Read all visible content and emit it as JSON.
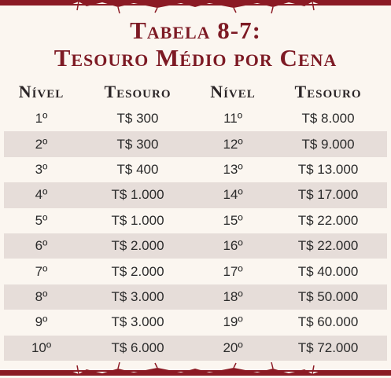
{
  "title": {
    "line1": "Tabela 8-7:",
    "line2": "Tesouro Médio por Cena"
  },
  "header": {
    "level_left": "Nível",
    "treasure_left": "Tesouro",
    "level_right": "Nível",
    "treasure_right": "Tesouro"
  },
  "rows": [
    {
      "level_a": "1º",
      "treasure_a": "T$ 300",
      "level_b": "11º",
      "treasure_b": "T$ 8.000"
    },
    {
      "level_a": "2º",
      "treasure_a": "T$ 300",
      "level_b": "12º",
      "treasure_b": "T$ 9.000"
    },
    {
      "level_a": "3º",
      "treasure_a": "T$ 400",
      "level_b": "13º",
      "treasure_b": "T$ 13.000"
    },
    {
      "level_a": "4º",
      "treasure_a": "T$ 1.000",
      "level_b": "14º",
      "treasure_b": "T$ 17.000"
    },
    {
      "level_a": "5º",
      "treasure_a": "T$ 1.000",
      "level_b": "15º",
      "treasure_b": "T$ 22.000"
    },
    {
      "level_a": "6º",
      "treasure_a": "T$ 2.000",
      "level_b": "16º",
      "treasure_b": "T$ 22.000"
    },
    {
      "level_a": "7º",
      "treasure_a": "T$ 2.000",
      "level_b": "17º",
      "treasure_b": "T$ 40.000"
    },
    {
      "level_a": "8º",
      "treasure_a": "T$ 3.000",
      "level_b": "18º",
      "treasure_b": "T$ 50.000"
    },
    {
      "level_a": "9º",
      "treasure_a": "T$ 3.000",
      "level_b": "19º",
      "treasure_b": "T$ 60.000"
    },
    {
      "level_a": "10º",
      "treasure_a": "T$ 6.000",
      "level_b": "20º",
      "treasure_b": "T$ 72.000"
    }
  ],
  "colors": {
    "accent": "#8b1a24",
    "background": "#fbf6f0",
    "row_shade": "#e6ddd9"
  }
}
